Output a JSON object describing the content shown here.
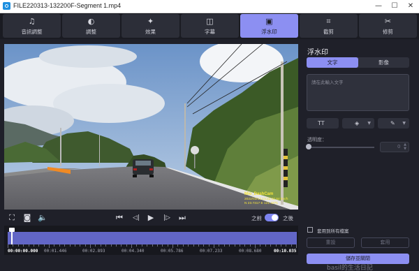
{
  "window": {
    "title": "FILE220313-132200F-Segment 1.mp4",
    "minimize": "—",
    "maximize": "☐",
    "close": "✕"
  },
  "tabs": [
    {
      "label": "音訊調整",
      "icon": "music-note-icon",
      "glyph": "♫"
    },
    {
      "label": "調整",
      "icon": "adjust-icon",
      "glyph": "◐"
    },
    {
      "label": "效果",
      "icon": "magic-wand-icon",
      "glyph": "✦"
    },
    {
      "label": "字幕",
      "icon": "subtitle-icon",
      "glyph": "◫"
    },
    {
      "label": "浮水印",
      "icon": "watermark-icon",
      "glyph": "▣",
      "active": true
    },
    {
      "label": "截剪",
      "icon": "crop-icon",
      "glyph": "⌗"
    },
    {
      "label": "修剪",
      "icon": "scissors-icon",
      "glyph": "✂"
    }
  ],
  "video": {
    "overlay_name": "Mio_DashCam",
    "overlay_gps_line1": "2022/03/13 13:22:42  64 km/h",
    "overlay_gps_line2": "N 23.7317  E 121.4271"
  },
  "controls": {
    "fullscreen": "⛶",
    "snapshot": "◙",
    "volume": "🔈",
    "skip_start": "⏮",
    "prev_frame": "◁|",
    "play": "▶",
    "next_frame": "|▷",
    "skip_end": "⏭",
    "before_label": "之前",
    "after_label": "之後"
  },
  "timeline": {
    "current": "00:00:00.000",
    "marks": [
      "00:01.446",
      "00:02.893",
      "00:04.340",
      "00:05.786",
      "00:07.233",
      "00:08.680"
    ],
    "end": "00:10.035",
    "playhead_progress": 0.0
  },
  "panel": {
    "title": "浮水印",
    "text_tab": "文字",
    "image_tab": "影像",
    "text_placeholder": "請在此輸入文字",
    "font_glyph": "TT",
    "fill_glyph": "◈",
    "color_glyph": "✎",
    "opacity_label": "透明度：",
    "opacity_value": "0",
    "apply_all_label": "套用到所有檔案",
    "reset_label": "重設",
    "apply_label": "套用",
    "save_close_label": "儲存並關閉"
  },
  "watermark_text": "basil的生活日記",
  "colors": {
    "accent": "#8c8ff2",
    "background": "#1f2029",
    "overlay_text": "#f6e53a"
  }
}
